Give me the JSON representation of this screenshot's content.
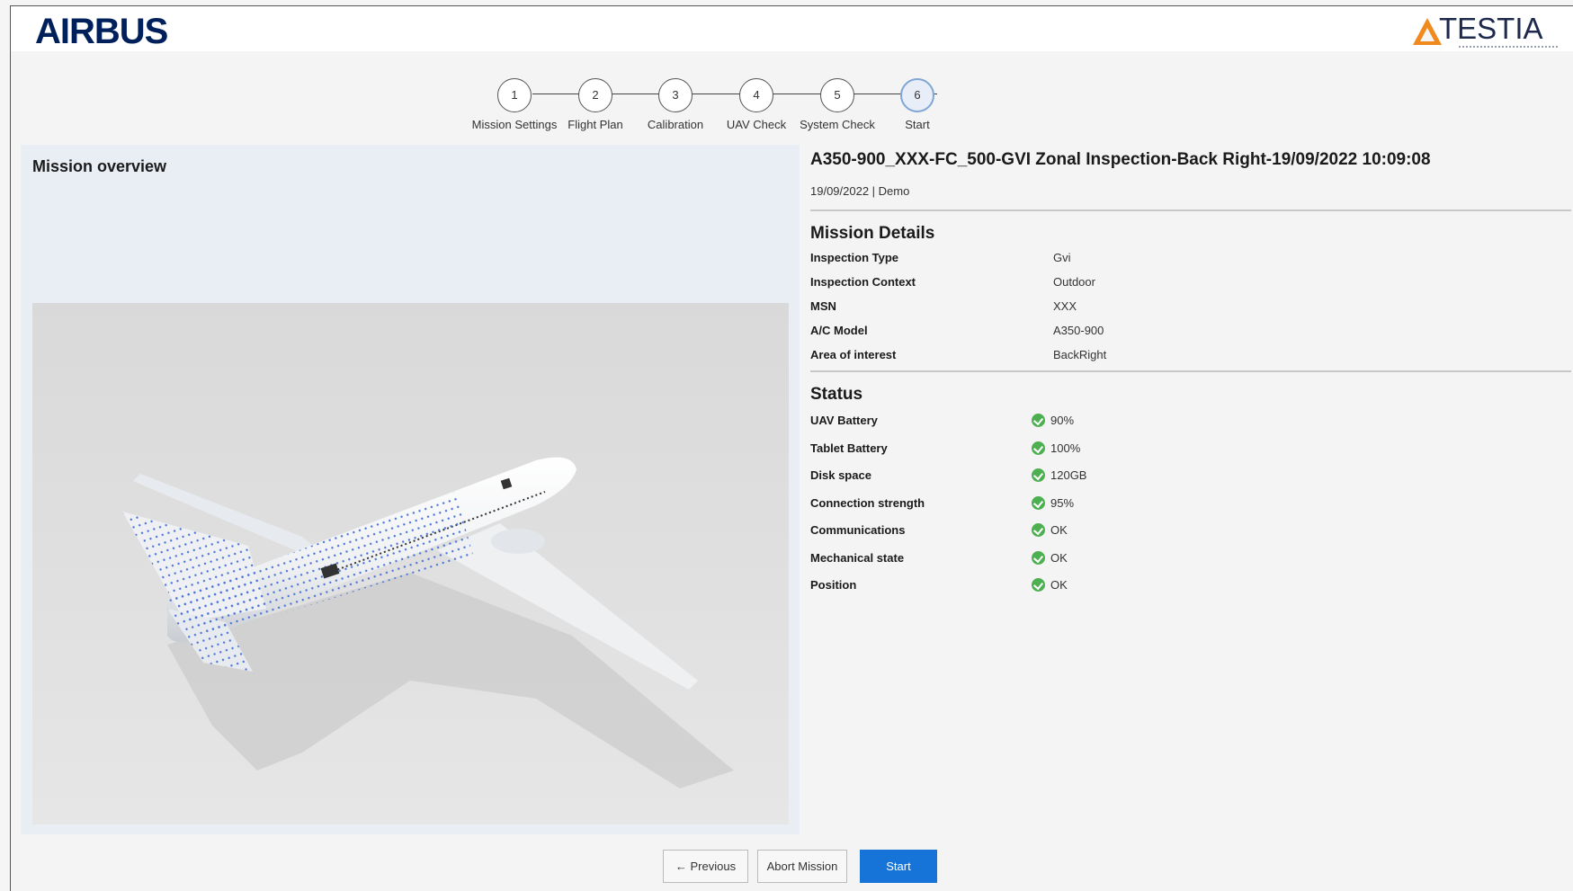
{
  "header": {
    "left_logo": "AIRBUS",
    "right_logo": "TESTIA"
  },
  "stepper": {
    "steps": [
      {
        "number": "1",
        "label": "Mission Settings"
      },
      {
        "number": "2",
        "label": "Flight Plan"
      },
      {
        "number": "3",
        "label": "Calibration"
      },
      {
        "number": "4",
        "label": "UAV Check"
      },
      {
        "number": "5",
        "label": "System Check"
      },
      {
        "number": "6",
        "label": "Start"
      }
    ],
    "active_step": 6
  },
  "overview": {
    "title": "Mission overview"
  },
  "mission": {
    "title": "A350-900_XXX-FC_500-GVI Zonal Inspection-Back Right-19/09/2022 10:09:08",
    "subtitle": "19/09/2022 | Demo"
  },
  "details": {
    "title": "Mission Details",
    "rows": [
      {
        "label": "Inspection Type",
        "value": "Gvi"
      },
      {
        "label": "Inspection Context",
        "value": "Outdoor"
      },
      {
        "label": "MSN",
        "value": "XXX"
      },
      {
        "label": "A/C Model",
        "value": "A350-900"
      },
      {
        "label": "Area of interest",
        "value": "BackRight"
      }
    ]
  },
  "status": {
    "title": "Status",
    "ok_color": "#4caf50",
    "rows": [
      {
        "label": "UAV Battery",
        "value": "90%"
      },
      {
        "label": "Tablet Battery",
        "value": "100%"
      },
      {
        "label": "Disk space",
        "value": "120GB"
      },
      {
        "label": "Connection strength",
        "value": "95%"
      },
      {
        "label": "Communications",
        "value": "OK"
      },
      {
        "label": "Mechanical state",
        "value": "OK"
      },
      {
        "label": "Position",
        "value": "OK"
      }
    ]
  },
  "footer": {
    "previous_label": "Previous",
    "abort_label": "Abort Mission",
    "start_label": "Start",
    "primary_color": "#1674d8"
  }
}
